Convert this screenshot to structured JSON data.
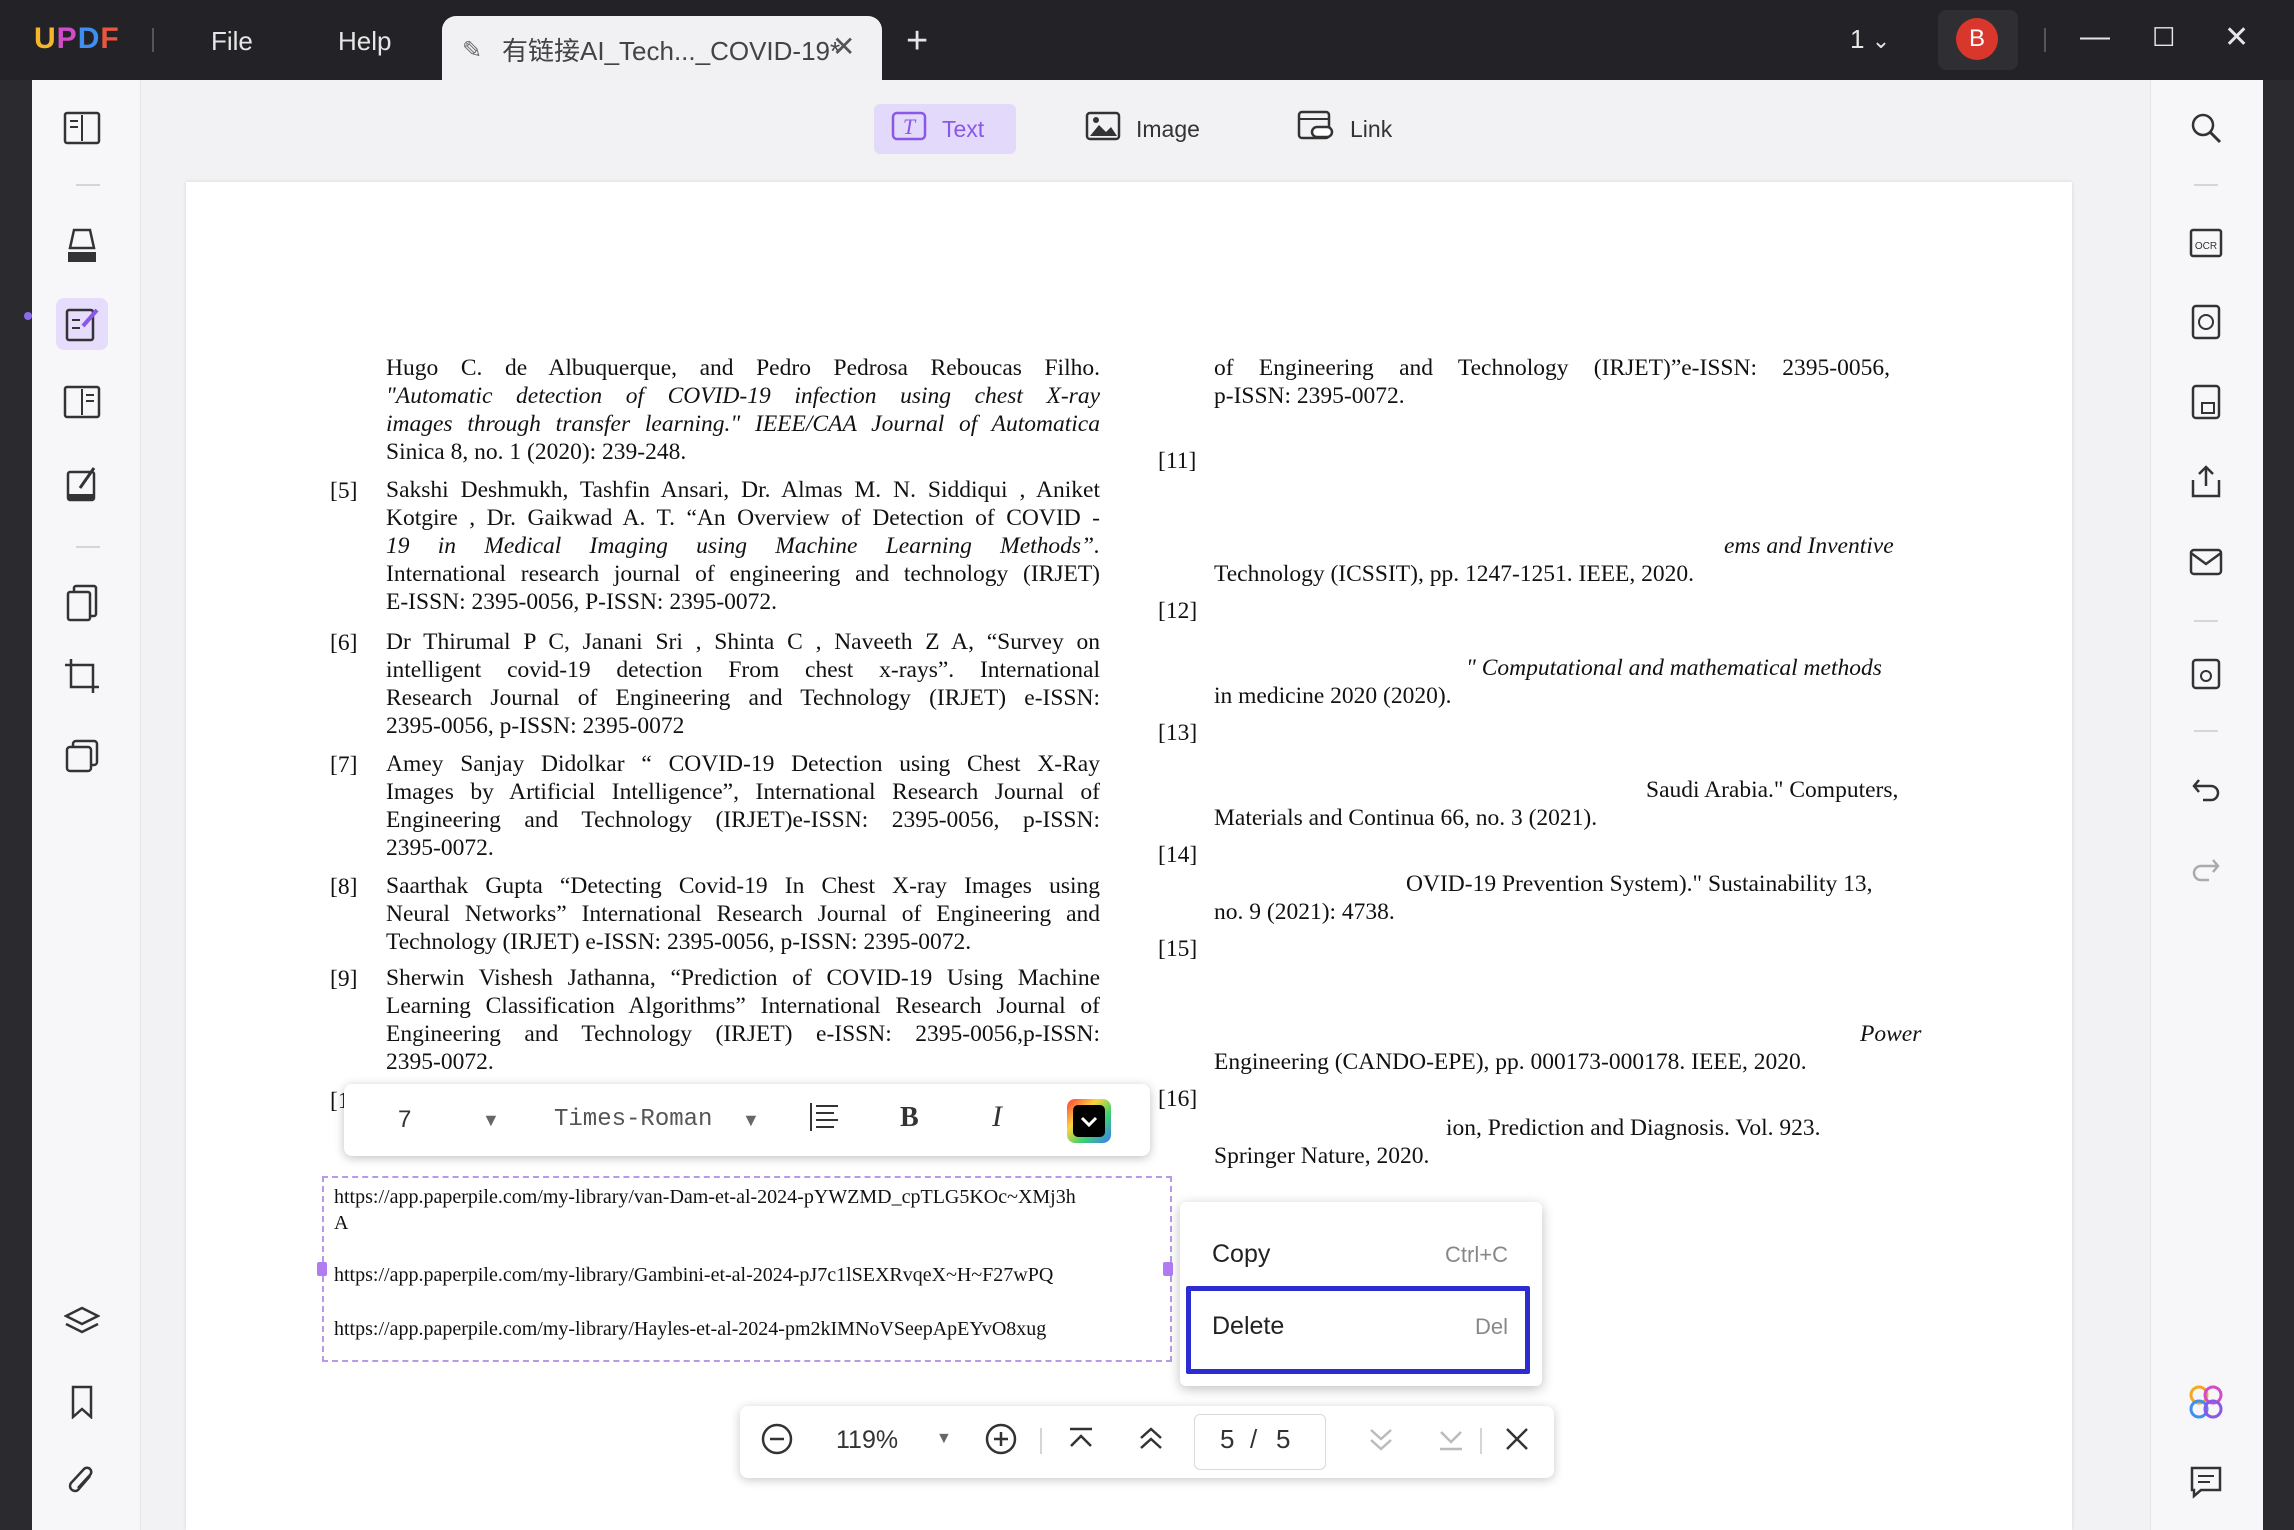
{
  "titlebar": {
    "logo": [
      "U",
      "P",
      "D",
      "F"
    ],
    "menu_file": "File",
    "menu_help": "Help",
    "tab_title": "有链接AI_Tech..._COVID-19*",
    "tab_close": "✕",
    "new_tab": "+",
    "page_indicator": "1",
    "avatar_initial": "B"
  },
  "toolbar": {
    "text": "Text",
    "image": "Image",
    "link": "Link"
  },
  "left_refs": {
    "r4_l1": "Hugo C. de Albuquerque, and Pedro Pedrosa Reboucas Filho.",
    "r4_l2": "\"Automatic detection of COVID-19 infection using chest X-ray",
    "r4_l3": "images through transfer learning.\" IEEE/CAA Journal of Automatica",
    "r4_l4": "Sinica 8, no. 1 (2020): 239-248.",
    "r5_num": "[5]",
    "r5_l1": "Sakshi Deshmukh, Tashfin Ansari, Dr. Almas M. N. Siddiqui , Aniket",
    "r5_l2": "Kotgire , Dr. Gaikwad A. T. “An Overview of Detection of COVID -",
    "r5_l3": "19 in Medical Imaging using Machine Learning Methods”.",
    "r5_l4": "International research journal of engineering and technology (IRJET)",
    "r5_l5": "E-ISSN: 2395-0056, P-ISSN: 2395-0072.",
    "r6_num": "[6]",
    "r6_l1": "Dr Thirumal P C, Janani Sri , Shinta C , Naveeth Z A, “Survey on",
    "r6_l2": "intelligent covid-19 detection From chest x-rays”. International",
    "r6_l3": "Research Journal of Engineering and Technology (IRJET) e-ISSN:",
    "r6_l4": "2395-0056, p-ISSN: 2395-0072",
    "r7_num": "[7]",
    "r7_l1": "Amey Sanjay Didolkar “ COVID-19 Detection using Chest X-Ray",
    "r7_l2": "Images by Artificial Intelligence”, International Research Journal of",
    "r7_l3": "Engineering and Technology (IRJET)e-ISSN: 2395-0056, p-ISSN:",
    "r7_l4": "2395-0072.",
    "r8_num": "[8]",
    "r8_l1": "Saarthak Gupta “Detecting Covid-19 In Chest X-ray Images using",
    "r8_l2": "Neural Networks” International Research Journal of Engineering and",
    "r8_l3": "Technology (IRJET) e-ISSN: 2395-0056, p-ISSN: 2395-0072.",
    "r9_num": "[9]",
    "r9_l1": "Sherwin Vishesh Jathanna, “Prediction of COVID-19 Using Machine",
    "r9_l2": "Learning Classification Algorithms” International Research Journal of",
    "r9_l3": "Engineering and Technology (IRJET) e-ISSN: 2395-0056,p-ISSN:",
    "r9_l4": "2395-0072.",
    "r10_num": "[1"
  },
  "right_refs": {
    "r10_l1": "of Engineering and Technology (IRJET)”e-ISSN: 2395-0056,",
    "r10_l2": "p-ISSN: 2395-0072.",
    "r11_num": "[11]",
    "r11_l3": "ems and Inventive",
    "r11_l4": "Technology (ICSSIT), pp. 1247-1251. IEEE, 2020.",
    "r12_num": "[12]",
    "r12_l2": "\" Computational and mathematical methods",
    "r12_l3": "in medicine 2020 (2020).",
    "r13_num": "[13]",
    "r13_l2": "Saudi Arabia.\" Computers,",
    "r13_l3": "Materials and Continua 66, no. 3 (2021).",
    "r14_num": "[14]",
    "r14_l1": "OVID-19 Prevention System).\" Sustainability 13,",
    "r14_l2": "no. 9 (2021): 4738.",
    "r15_num": "[15]",
    "r15_l3": "Power",
    "r15_l4": "Engineering (CANDO-EPE), pp. 000173-000178. IEEE, 2020.",
    "r16_num": "[16]",
    "r16_l1": "ion, Prediction and Diagnosis. Vol. 923.",
    "r16_l2": "Springer Nature, 2020."
  },
  "format_bar": {
    "font_size": "7",
    "font_name": "Times-Roman",
    "bold": "B",
    "italic": "I"
  },
  "selection": {
    "url1_a": "https://app.paperpile.com/my-library/van-Dam-et-al-2024-pYWZMD_cpTLG5KOc~XMj3h",
    "url1_b": "A",
    "url2": "https://app.paperpile.com/my-library/Gambini-et-al-2024-pJ7c1lSEXRvqeX~H~F27wPQ",
    "url3": "https://app.paperpile.com/my-library/Hayles-et-al-2024-pm2kIMNoVSeepApEYvO8xug"
  },
  "context_menu": {
    "copy": "Copy",
    "copy_shortcut": "Ctrl+C",
    "delete": "Delete",
    "delete_shortcut": "Del"
  },
  "nav": {
    "zoom": "119%",
    "page_current": "5",
    "page_sep": "/",
    "page_total": "5"
  },
  "colors": {
    "accent": "#8a58e8",
    "highlight_border": "#2c2cd1",
    "avatar": "#d9372b"
  }
}
